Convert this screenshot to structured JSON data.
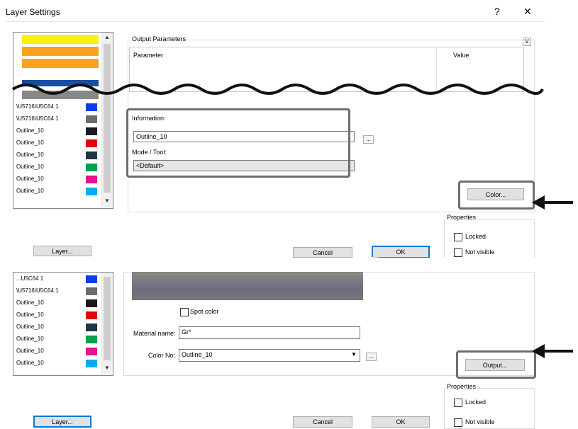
{
  "window": {
    "title": "Layer Settings",
    "help_glyph": "?",
    "close_glyph": "✕"
  },
  "colors": {
    "accent": "#0078d7",
    "swatches_top": [
      "#f7f20c",
      "#f9a21b",
      "#f9a21b",
      "#1a4fa0",
      "#888888"
    ]
  },
  "top": {
    "layers": [
      {
        "name": "\\U5716\\U5C64 1",
        "color": "#0a3cf0"
      },
      {
        "name": "\\U5716\\U5C64 1",
        "color": "#6b6b6b"
      },
      {
        "name": "Outline_10",
        "color": "#1a1a1a"
      },
      {
        "name": "Outline_10",
        "color": "#e3000f"
      },
      {
        "name": "Outline_10",
        "color": "#1f3740"
      },
      {
        "name": "Outline_10",
        "color": "#00a14b"
      },
      {
        "name": "Outline_10",
        "color": "#e5128b"
      },
      {
        "name": "Outline_10",
        "color": "#00aeef"
      }
    ],
    "output_parameters_label": "Output Parameters",
    "collapse_glyph": "V",
    "col_parameter": "Parameter",
    "col_value": "Value",
    "information_label": "Information:",
    "information_value": "Outline_10",
    "mode_label": "Mode / Tool:",
    "mode_value": "<Default>",
    "browse_glyph": "...",
    "color_button": "Color...",
    "properties_label": "Properties",
    "locked_label": "Locked",
    "not_visible_label": "Not visible",
    "layer_button": "Layer...",
    "cancel_button": "Cancel",
    "ok_button": "OK"
  },
  "bottom": {
    "layers": [
      {
        "name": "...U5C64 1",
        "color": "#0a3cf0"
      },
      {
        "name": "\\U5716\\U5C64 1",
        "color": "#6b6b6b"
      },
      {
        "name": "Outline_10",
        "color": "#1a1a1a"
      },
      {
        "name": "Outline_10",
        "color": "#e3000f"
      },
      {
        "name": "Outline_10",
        "color": "#1f3740"
      },
      {
        "name": "Outline_10",
        "color": "#00a14b"
      },
      {
        "name": "Outline_10",
        "color": "#e5128b"
      },
      {
        "name": "Outline_10",
        "color": "#00aeef"
      }
    ],
    "spot_color_label": "Spot color",
    "material_label": "Material name:",
    "material_value": "Gr*",
    "color_no_label": "Color No:",
    "color_no_value": "Outline_10",
    "browse_glyph": "...",
    "output_button": "Output...",
    "properties_label": "Properties",
    "locked_label": "Locked",
    "not_visible_label": "Not visible",
    "layer_button": "Layer...",
    "cancel_button": "Cancel",
    "ok_button": "OK"
  },
  "arrows": {
    "glyph": "⟵"
  }
}
